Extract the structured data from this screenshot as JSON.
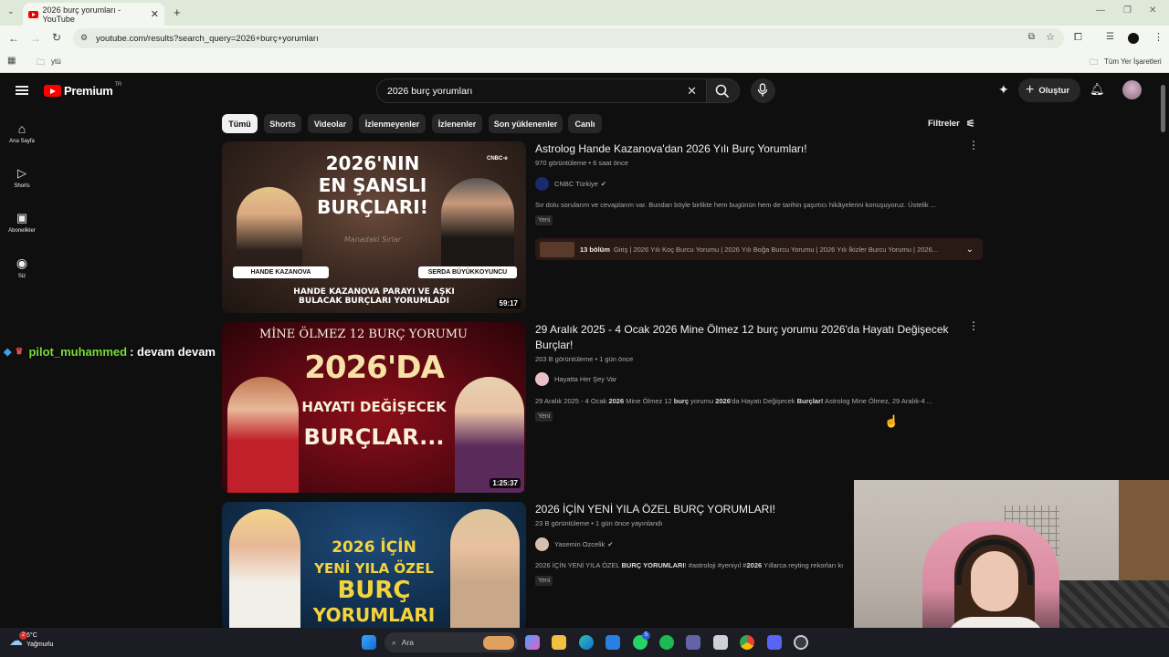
{
  "browser": {
    "tab_title": "2026 burç yorumları - YouTube",
    "url": "youtube.com/results?search_query=2026+burç+yorumları",
    "bookmark": "ytü",
    "all_bookmarks": "Tüm Yer İşaretleri"
  },
  "youtube": {
    "logo_text": "Premium",
    "region": "TR",
    "search_value": "2026 burç yorumları",
    "create_label": "Oluştur",
    "sidebar": [
      {
        "label": "Ana Sayfa",
        "icon": "home-icon"
      },
      {
        "label": "Shorts",
        "icon": "shorts-icon"
      },
      {
        "label": "Abonelikler",
        "icon": "subscriptions-icon"
      },
      {
        "label": "Siz",
        "icon": "you-icon"
      }
    ],
    "chips": [
      "Tümü",
      "Shorts",
      "Videolar",
      "İzlenmeyenler",
      "İzlenenler",
      "Son yüklenenler",
      "Canlı"
    ],
    "filters_label": "Filtreler",
    "videos": [
      {
        "title": "Astrolog Hande Kazanova'dan 2026 Yılı Burç Yorumları!",
        "meta": "970 görüntüleme • 6 saat önce",
        "channel": "CNBC Türkiye",
        "description": "Sır dolu sorularım ve cevaplarım var. Bundan böyle birlikte hem bugünün hem de tarihin şaşırtıcı hikâyelerini konuşuyoruz. Üstelik ...",
        "badge": "Yeni",
        "duration": "59:17",
        "chapters_count": "13 bölüm",
        "chapters": "Giriş | 2026 Yılı Koç Burcu Yorumu | 2026 Yılı Boğa Burcu Yorumu | 2026 Yılı İkizler Burcu Yorumu | 2026...",
        "thumb": {
          "headline1": "2026'NIN",
          "headline2": "EN ŞANSLI",
          "headline3": "BURÇLARI!",
          "left_name": "HANDE KAZANOVA",
          "right_name": "SERDA BÜYÜKKOYUNCU",
          "show": "Manadaki Sırlar",
          "bottom1": "HANDE KAZANOVA PARAYI VE AŞKI",
          "bottom2": "BULACAK BURÇLARI YORUMLADI",
          "brand": "CNBC-e"
        }
      },
      {
        "title": "29 Aralık 2025 - 4 Ocak 2026 Mine Ölmez 12 burç yorumu 2026'da Hayatı Değişecek Burçlar!",
        "meta": "203 B görüntüleme • 1 gün önce",
        "channel": "Hayatta Her Şey Var",
        "description_prefix": "29 Aralık 2025 - 4 Ocak ",
        "description_bold1": "2026",
        "description_mid1": " Mine Ölmez 12 ",
        "description_bold2": "burç",
        "description_mid2": " yorumu ",
        "description_bold3": "2026",
        "description_mid3": "'da Hayatı Değişecek ",
        "description_bold4": "Burçlar!",
        "description_suffix": " Astrolog Mine Ölmez, 29 Aralık-4 ...",
        "badge": "Yeni",
        "duration": "1:25:37",
        "thumb": {
          "top": "MİNE ÖLMEZ 12 BURÇ YORUMU",
          "line1": "2026'DA",
          "line2": "HAYATI DEĞİŞECEK",
          "line3": "BURÇLAR..."
        }
      },
      {
        "title": "2026 İÇİN YENİ YILA ÖZEL BURÇ YORUMLARI!",
        "meta": "23 B görüntüleme • 1 gün önce yayınlandı",
        "channel": "Yasemin Ozcelik",
        "description_prefix": "2026 İÇİN YENİ YILA ÖZEL ",
        "description_bold1": "BURÇ YORUMLARI",
        "description_mid1": "! #astroloji #yeniyıl #",
        "description_bold2": "2026",
        "description_suffix": " Yıllarca reyting rekorları kı",
        "badge": "Yeni",
        "thumb": {
          "line1": "2026 İÇİN",
          "line2": "YENİ YILA ÖZEL",
          "line3": "BURÇ",
          "line4": "YORUMLARI"
        }
      }
    ]
  },
  "overlay_chat": {
    "user": "pilot_muhammed",
    "message": ": devam devam"
  },
  "taskbar": {
    "temp": "6°C",
    "weather": "Yağmurlu",
    "search_placeholder": "Ara",
    "notif_count": "2",
    "teams_count": "5"
  },
  "colors": {
    "yt_red": "#ff0000",
    "bg": "#0f0f0f",
    "chat_user": "#7cdc3c"
  }
}
